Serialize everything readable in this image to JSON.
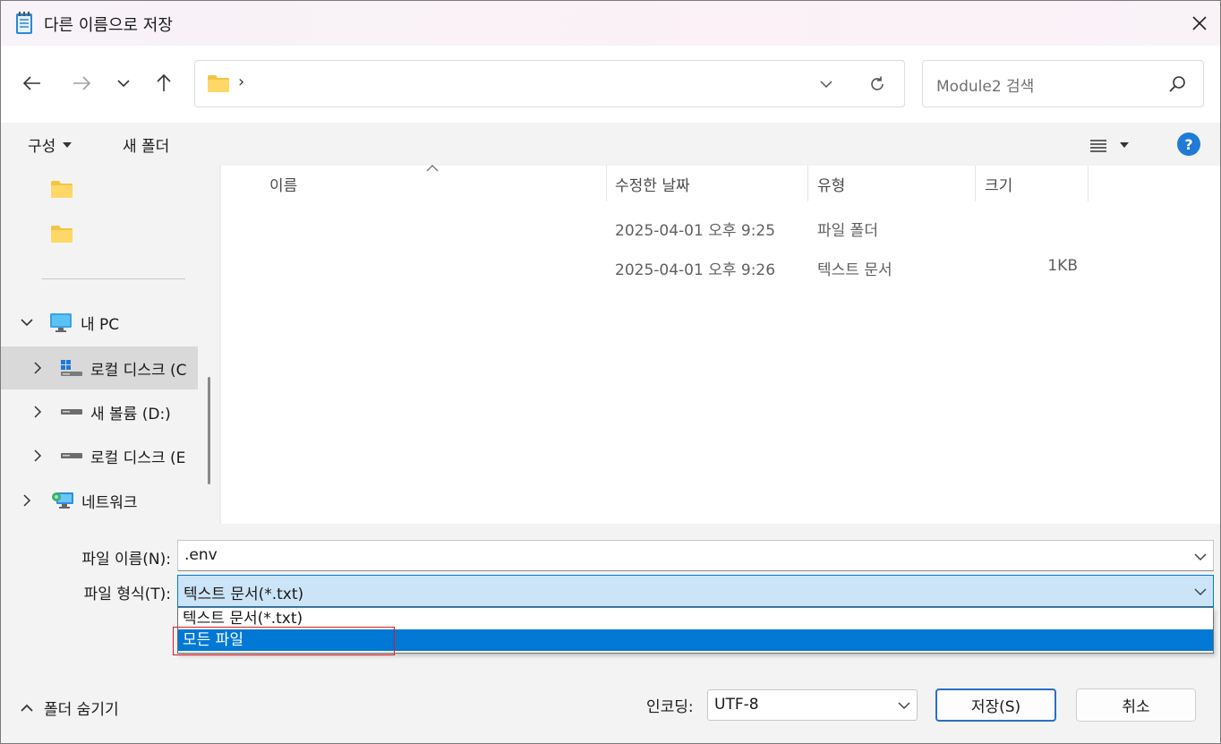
{
  "window": {
    "title": "다른 이름으로 저장"
  },
  "address": {
    "separator": "›"
  },
  "search": {
    "placeholder": "Module2 검색"
  },
  "toolbar": {
    "organize_label": "구성",
    "new_folder_label": "새 폴더",
    "help_label": "?"
  },
  "navpane": {
    "tree": [
      {
        "label": "내 PC",
        "icon": "monitor-icon",
        "expanded": true
      },
      {
        "label": "로컬 디스크 (C",
        "icon": "windows-drive-icon",
        "selected": true
      },
      {
        "label": "새 볼륨 (D:)",
        "icon": "drive-icon"
      },
      {
        "label": "로컬 디스크 (E",
        "icon": "drive-icon"
      },
      {
        "label": "네트워크",
        "icon": "network-icon"
      }
    ]
  },
  "filelist": {
    "columns": [
      "이름",
      "수정한 날짜",
      "유형",
      "크기"
    ],
    "rows": [
      {
        "name": "",
        "modified": "2025-04-01 오후 9:25",
        "type": "파일 폴더",
        "size": ""
      },
      {
        "name": "",
        "modified": "2025-04-01 오후 9:26",
        "type": "텍스트 문서",
        "size": "1KB"
      }
    ]
  },
  "form": {
    "filename_label": "파일 이름(N):",
    "filename_value": ".env",
    "filetype_label": "파일 형식(T):",
    "filetype_value": "텍스트 문서(*.txt)",
    "filetype_options": [
      "텍스트 문서(*.txt)",
      "모든 파일"
    ],
    "hide_folders_label": "폴더 숨기기",
    "encoding_label": "인코딩:",
    "encoding_value": "UTF-8",
    "save_label": "저장(S)",
    "cancel_label": "취소"
  },
  "colors": {
    "accent": "#0078d4",
    "highlight_border": "#e0191f",
    "selection_bg": "#cce4f7"
  }
}
